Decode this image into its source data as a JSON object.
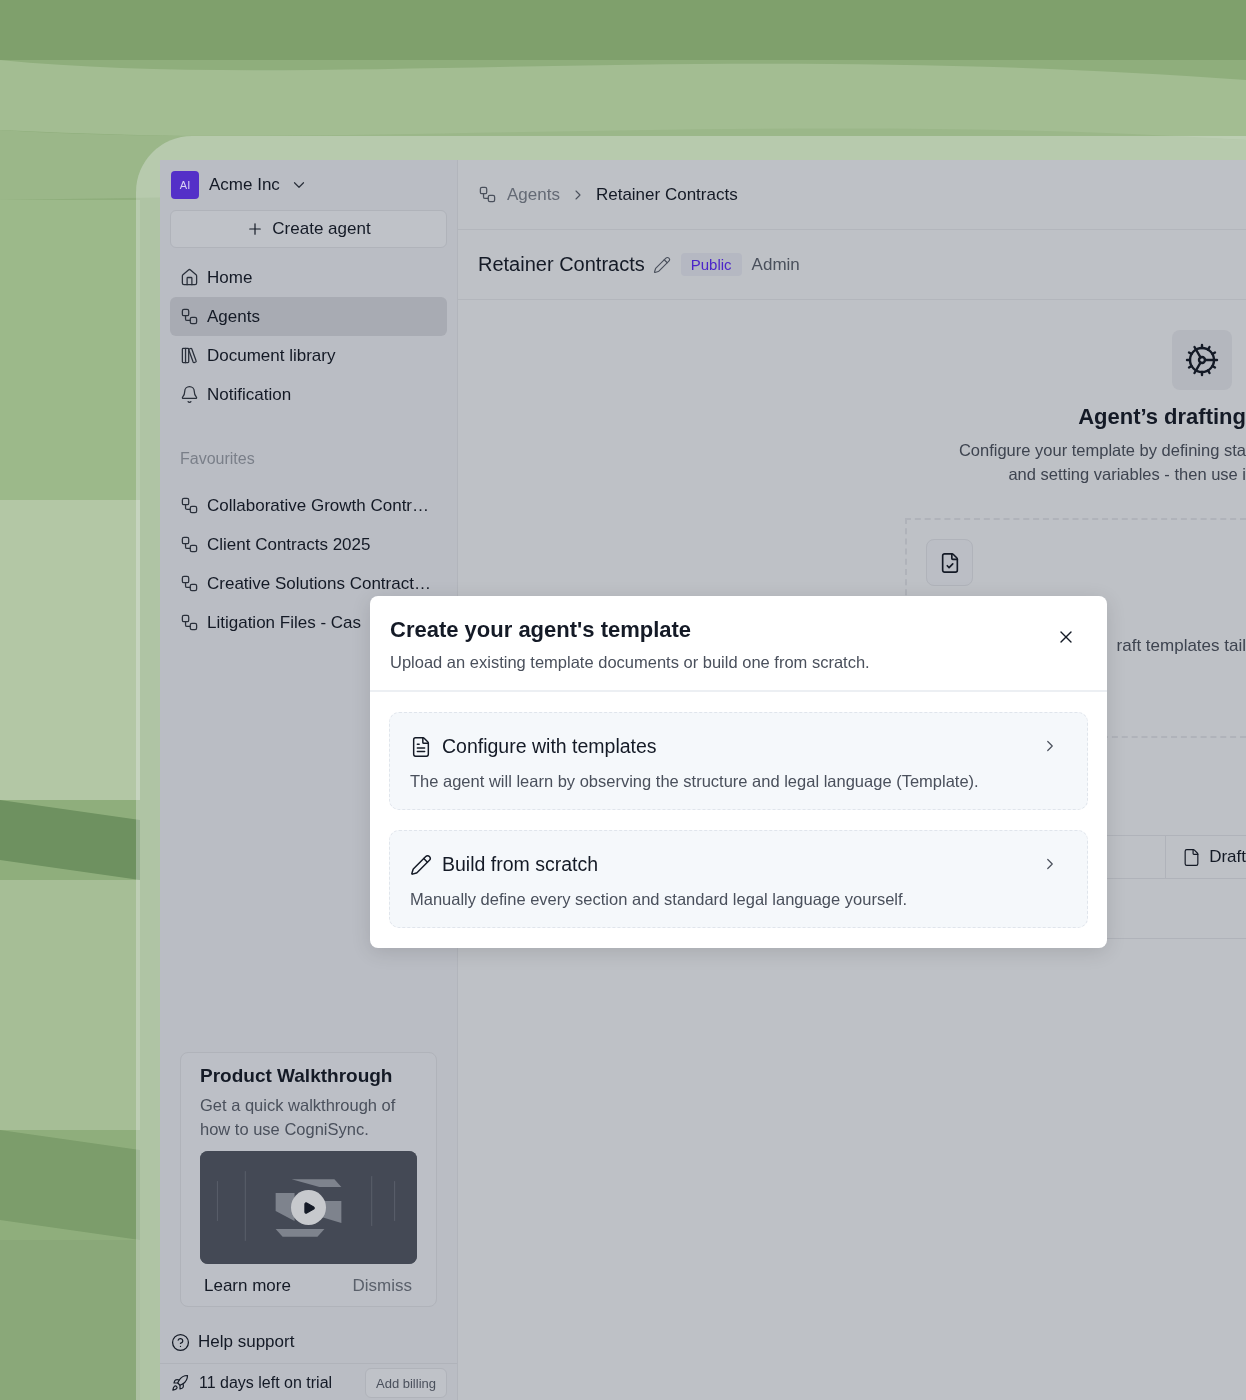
{
  "sidebar": {
    "workspace": {
      "avatar": "AI",
      "name": "Acme Inc"
    },
    "create_button": "Create agent",
    "nav": [
      {
        "kind": "home",
        "label": "Home",
        "selected": false
      },
      {
        "kind": "agents",
        "label": "Agents",
        "selected": true
      },
      {
        "kind": "library",
        "label": "Document library",
        "selected": false
      },
      {
        "kind": "bell",
        "label": "Notification",
        "selected": false
      }
    ],
    "favourites": {
      "title": "Favourites",
      "items": [
        "Collaborative Growth Contr…",
        "Client Contracts 2025",
        "Creative Solutions Contract…",
        "Litigation Files - Cas"
      ]
    },
    "walkthrough": {
      "title": "Product Walkthrough",
      "description": "Get a quick walkthrough of how to use CogniSync.",
      "learn_more": "Learn more",
      "dismiss": "Dismiss"
    },
    "help": "Help support",
    "trial": {
      "text": "11 days left on trial",
      "button": "Add billing"
    }
  },
  "breadcrumb": [
    "Agents",
    "Retainer Contracts"
  ],
  "header": {
    "title": "Retainer Contracts",
    "badge": "Public",
    "role": "Admin"
  },
  "drafting": {
    "title": "Agent’s drafting",
    "description_lines": [
      "Configure your template by defining sta",
      "and setting variables - then use i"
    ],
    "upload_text": "raft templates tail",
    "tab": "Draft"
  },
  "dialog": {
    "title": "Create your agent's template",
    "subtitle": "Upload an existing template documents or build one from scratch.",
    "options": [
      {
        "kind": "document",
        "title": "Configure with templates",
        "description": "The agent will learn by observing the structure and legal language (Template)."
      },
      {
        "kind": "pencil",
        "title": "Build from scratch",
        "description": "Manually define every section and standard legal language yourself."
      }
    ]
  }
}
